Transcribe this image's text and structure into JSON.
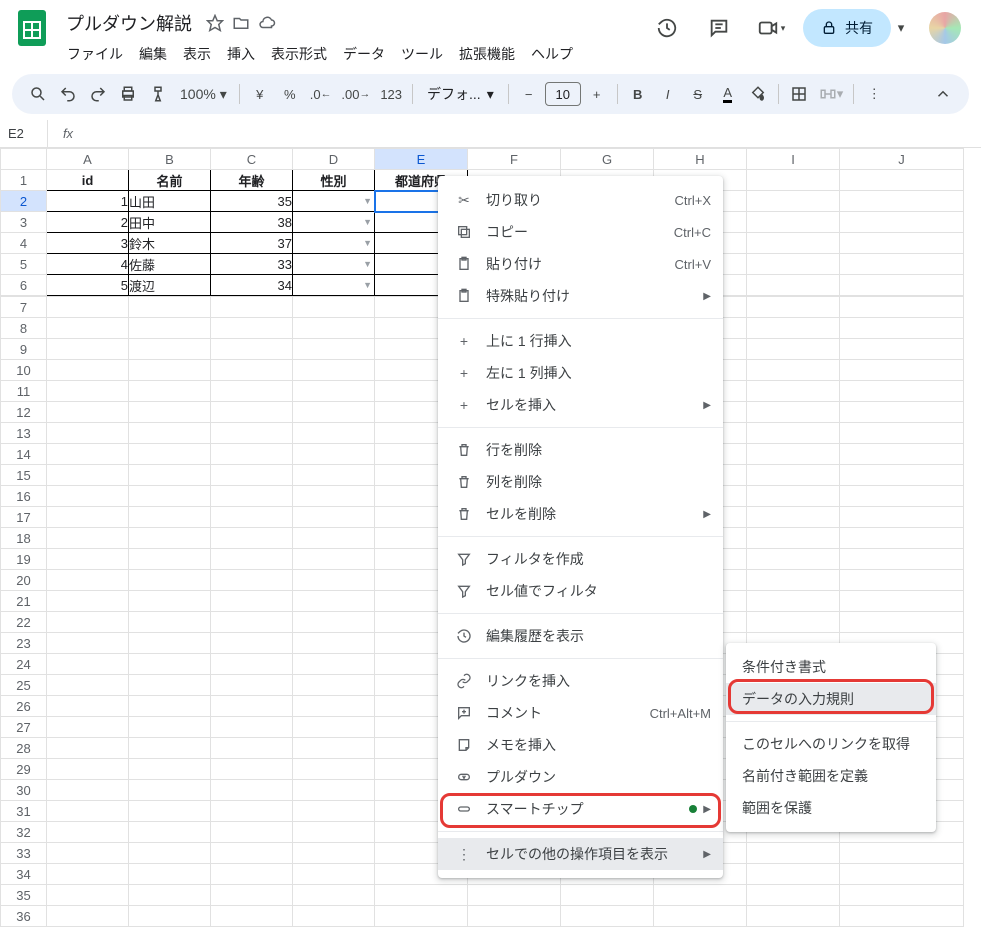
{
  "doc": {
    "title": "プルダウン解説"
  },
  "menu": [
    "ファイル",
    "編集",
    "表示",
    "挿入",
    "表示形式",
    "データ",
    "ツール",
    "拡張機能",
    "ヘルプ"
  ],
  "share": "共有",
  "toolbar": {
    "zoom": "100%",
    "font": "デフォ...",
    "size": "10"
  },
  "name_box": "E2",
  "columns": [
    "A",
    "B",
    "C",
    "D",
    "E",
    "F",
    "G",
    "H",
    "I",
    "J"
  ],
  "headers": [
    "id",
    "名前",
    "年齢",
    "性別",
    "都道府県"
  ],
  "rows": [
    {
      "id": "1",
      "name": "山田",
      "age": "35"
    },
    {
      "id": "2",
      "name": "田中",
      "age": "38"
    },
    {
      "id": "3",
      "name": "鈴木",
      "age": "37"
    },
    {
      "id": "4",
      "name": "佐藤",
      "age": "33"
    },
    {
      "id": "5",
      "name": "渡辺",
      "age": "34"
    }
  ],
  "ctx": {
    "cut": "切り取り",
    "cut_sc": "Ctrl+X",
    "copy": "コピー",
    "copy_sc": "Ctrl+C",
    "paste": "貼り付け",
    "paste_sc": "Ctrl+V",
    "paste_special": "特殊貼り付け",
    "insert_row": "上に 1 行挿入",
    "insert_col": "左に 1 列挿入",
    "insert_cells": "セルを挿入",
    "delete_row": "行を削除",
    "delete_col": "列を削除",
    "delete_cells": "セルを削除",
    "create_filter": "フィルタを作成",
    "filter_by_value": "セル値でフィルタ",
    "show_edit_history": "編集履歴を表示",
    "insert_link": "リンクを挿入",
    "comment": "コメント",
    "comment_sc": "Ctrl+Alt+M",
    "insert_note": "メモを挿入",
    "dropdown": "プルダウン",
    "smart_chip": "スマートチップ",
    "more": "セルでの他の操作項目を表示"
  },
  "submenu": {
    "conditional_format": "条件付き書式",
    "data_validation": "データの入力規則",
    "get_link": "このセルへのリンクを取得",
    "define_named_range": "名前付き範囲を定義",
    "protect_range": "範囲を保護"
  }
}
